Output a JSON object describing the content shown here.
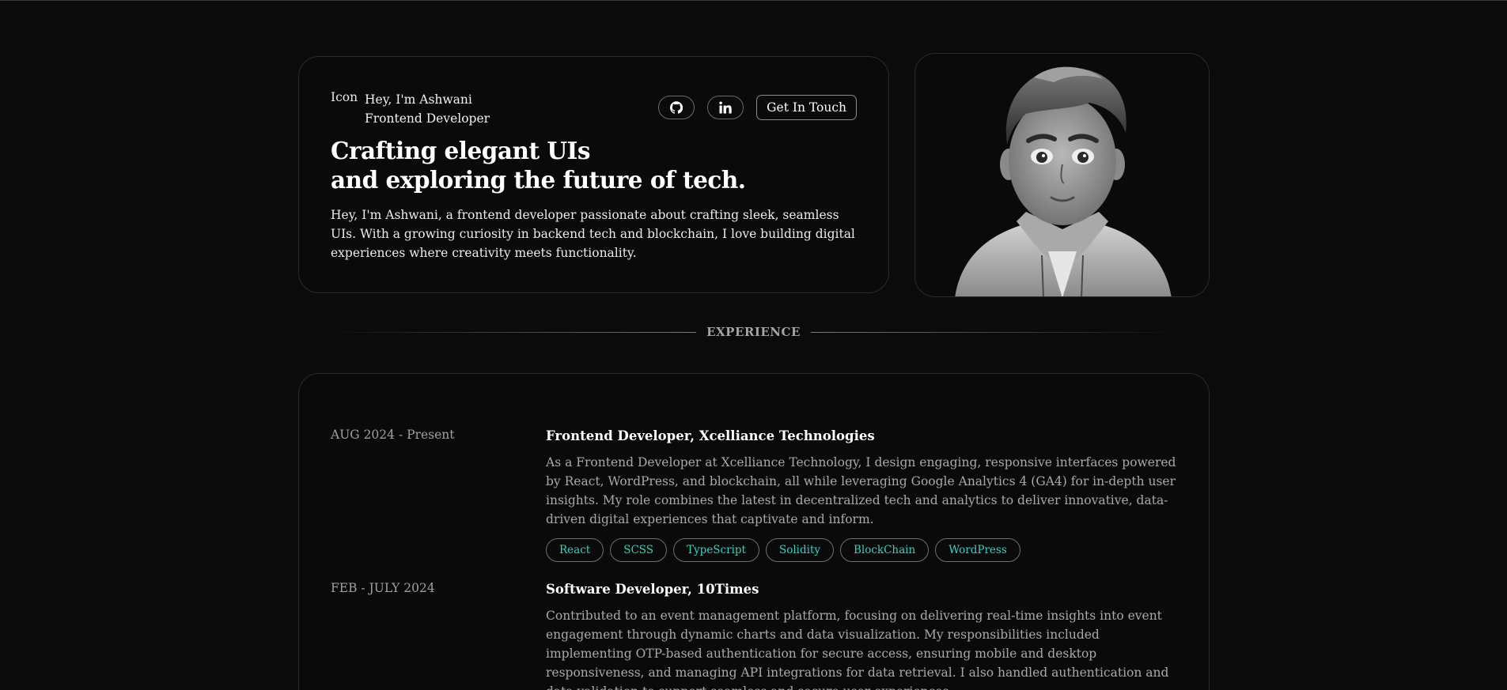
{
  "hero": {
    "icon_text": "Icon",
    "greeting": "Hey, I'm Ashwani",
    "role": "Frontend Developer",
    "headline_line1": "Crafting elegant UIs",
    "headline_line2": "and exploring the future of tech.",
    "description": "Hey, I'm Ashwani, a frontend developer passionate about crafting sleek, seamless UIs. With a growing curiosity in backend tech and blockchain, I love building digital experiences where creativity meets functionality.",
    "github_icon": "github-icon",
    "linkedin_icon": "linkedin-icon",
    "contact_label": "Get In Touch"
  },
  "section": {
    "experience_label": "EXPERIENCE"
  },
  "experience": [
    {
      "date": "AUG 2024 - Present",
      "title": "Frontend Developer, Xcelliance Technologies",
      "description": "As a Frontend Developer at Xcelliance Technology, I design engaging, responsive interfaces powered by React, WordPress, and blockchain, all while leveraging Google Analytics 4 (GA4) for in-depth user insights. My role combines the latest in decentralized tech and analytics to deliver innovative, data-driven digital experiences that captivate and inform.",
      "tags": [
        "React",
        "SCSS",
        "TypeScript",
        "Solidity",
        "BlockChain",
        "WordPress"
      ]
    },
    {
      "date": "FEB - JULY 2024",
      "title": "Software Developer, 10Times",
      "description": "Contributed to an event management platform, focusing on delivering real-time insights into event engagement through dynamic charts and data visualization. My responsibilities included implementing OTP-based authentication for secure access, ensuring mobile and desktop responsiveness, and managing API integrations for data retrieval. I also handled authentication and data validation to support seamless and secure user experiences."
    }
  ],
  "colors": {
    "background": "#0b0b0b",
    "card_border": "#2b2b2b",
    "tag_text": "#3ad0c0",
    "muted_text": "#a9a9a9"
  }
}
